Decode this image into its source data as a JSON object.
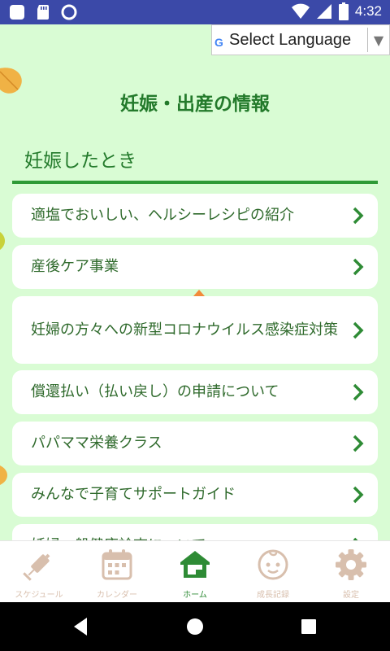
{
  "status_bar": {
    "time": "4:32"
  },
  "language_selector": {
    "g_logo": "G",
    "label": "Select Language",
    "arrow": "▼"
  },
  "page": {
    "title": "妊娠・出産の情報",
    "section_heading": "妊娠したとき"
  },
  "menu_items": [
    {
      "label": "適塩でおいしい、ヘルシーレシピの紹介"
    },
    {
      "label": "産後ケア事業"
    },
    {
      "label": "妊婦の方々への新型コロナウイルス感染症対策"
    },
    {
      "label": "償還払い（払い戻し）の申請について"
    },
    {
      "label": "パパママ栄養クラス"
    },
    {
      "label": "みんなで子育てサポートガイド"
    },
    {
      "label": "妊婦一般健康診査について"
    }
  ],
  "bottom_nav": [
    {
      "label": "スケジュール",
      "icon": "syringe-icon"
    },
    {
      "label": "カレンダー",
      "icon": "calendar-icon"
    },
    {
      "label": "ホーム",
      "icon": "home-icon",
      "active": true
    },
    {
      "label": "成長記録",
      "icon": "baby-face-icon"
    },
    {
      "label": "設定",
      "icon": "gear-icon"
    }
  ],
  "colors": {
    "accent_green": "#2e8b35",
    "background": "#d9fcd4",
    "status_bar": "#3b49a8",
    "inactive_tab": "#d8bfad"
  }
}
